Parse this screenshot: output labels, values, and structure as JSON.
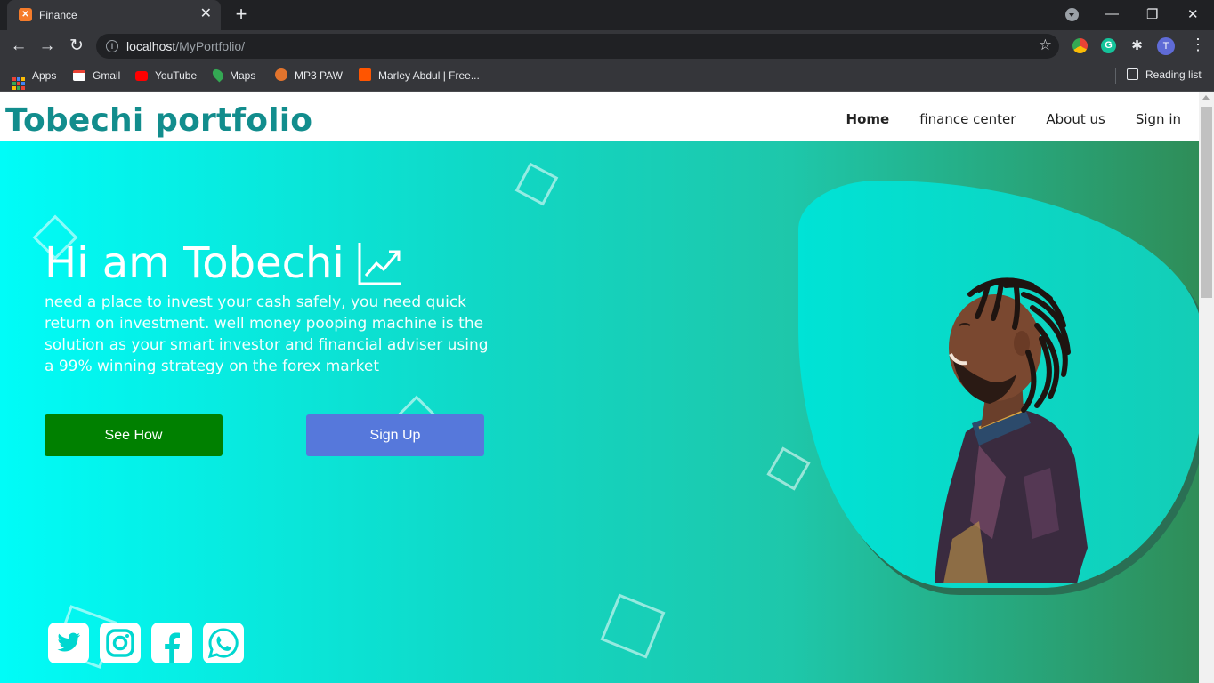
{
  "browser": {
    "tab_title": "Finance",
    "url_host": "localhost",
    "url_path": "/MyPortfolio/",
    "avatar_initial": "T",
    "bookmarks": [
      {
        "label": "Apps",
        "icon": "apps-grid-icon"
      },
      {
        "label": "Gmail",
        "icon": "gmail-icon",
        "color": "#ea4335"
      },
      {
        "label": "YouTube",
        "icon": "youtube-icon",
        "color": "#ff0000"
      },
      {
        "label": "Maps",
        "icon": "maps-pin-icon",
        "color": "#34a853"
      },
      {
        "label": "MP3 PAW",
        "icon": "paw-icon",
        "color": "#e2742d"
      },
      {
        "label": "Marley Abdul | Free...",
        "icon": "soundcloud-icon",
        "color": "#ff5500"
      }
    ],
    "reading_list": "Reading list"
  },
  "site": {
    "brand": "Tobechi portfolio",
    "nav": [
      {
        "label": "Home",
        "active": true
      },
      {
        "label": "finance center",
        "active": false
      },
      {
        "label": "About us",
        "active": false
      },
      {
        "label": "Sign in",
        "active": false
      }
    ],
    "hero": {
      "title": "Hi am Tobechi",
      "text": "need a place to invest your cash safely, you need quick return on investment. well money pooping machine is the solution as your smart investor and financial adviser using a 99% winning strategy on the forex market",
      "btn_primary": "See How",
      "btn_secondary": "Sign Up"
    },
    "social": [
      "twitter-icon",
      "instagram-icon",
      "facebook-icon",
      "whatsapp-icon"
    ],
    "colors": {
      "brand": "#128d8d",
      "see_how": "#008000",
      "sign_up": "#5678db"
    }
  }
}
